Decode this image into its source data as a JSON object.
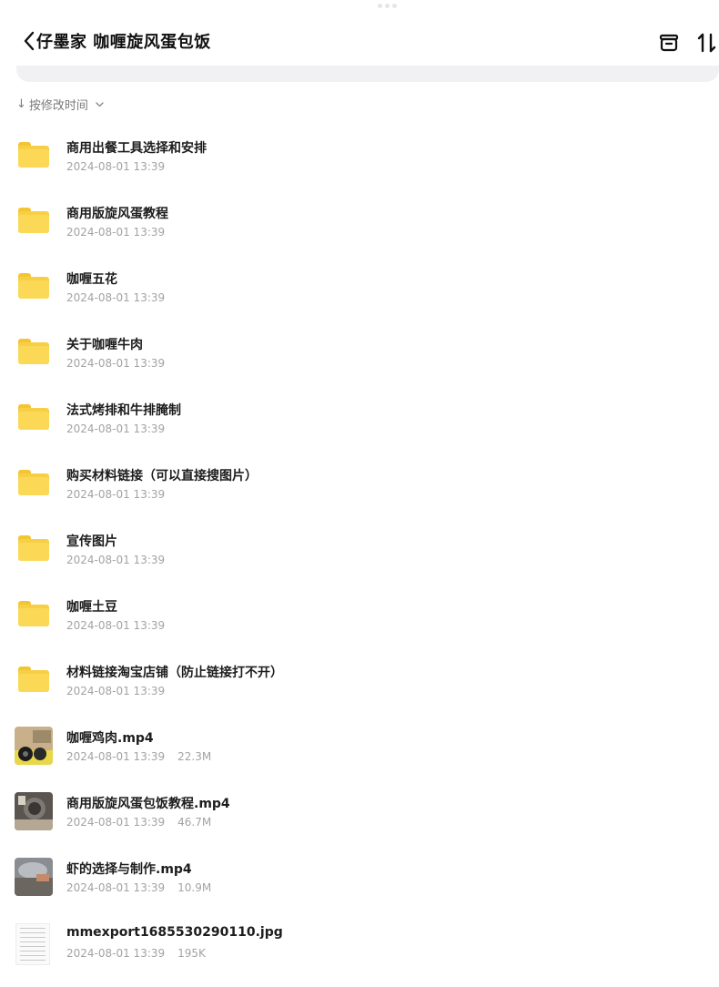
{
  "header": {
    "title": "仔墨家  咖喱旋风蛋包饭"
  },
  "sort": {
    "label": "按修改时间"
  },
  "files": [
    {
      "type": "folder",
      "name": "商用出餐工具选择和安排",
      "date": "2024-08-01 13:39",
      "size": ""
    },
    {
      "type": "folder",
      "name": "商用版旋风蛋教程",
      "date": "2024-08-01 13:39",
      "size": ""
    },
    {
      "type": "folder",
      "name": "咖喱五花",
      "date": "2024-08-01 13:39",
      "size": ""
    },
    {
      "type": "folder",
      "name": "关于咖喱牛肉",
      "date": "2024-08-01 13:39",
      "size": ""
    },
    {
      "type": "folder",
      "name": "法式烤排和牛排腌制",
      "date": "2024-08-01 13:39",
      "size": ""
    },
    {
      "type": "folder",
      "name": "购买材料链接（可以直接搜图片）",
      "date": "2024-08-01 13:39",
      "size": ""
    },
    {
      "type": "folder",
      "name": "宣传图片",
      "date": "2024-08-01 13:39",
      "size": ""
    },
    {
      "type": "folder",
      "name": "咖喱土豆",
      "date": "2024-08-01 13:39",
      "size": ""
    },
    {
      "type": "folder",
      "name": "材料链接淘宝店铺（防止链接打不开）",
      "date": "2024-08-01 13:39",
      "size": ""
    },
    {
      "type": "video",
      "name": "咖喱鸡肉.mp4",
      "date": "2024-08-01 13:39",
      "size": "22.3M"
    },
    {
      "type": "video",
      "name": "商用版旋风蛋包饭教程.mp4",
      "date": "2024-08-01 13:39",
      "size": "46.7M"
    },
    {
      "type": "video",
      "name": "虾的选择与制作.mp4",
      "date": "2024-08-01 13:39",
      "size": "10.9M"
    },
    {
      "type": "image",
      "name": "mmexport1685530290110.jpg",
      "date": "2024-08-01 13:39",
      "size": "195K"
    }
  ]
}
